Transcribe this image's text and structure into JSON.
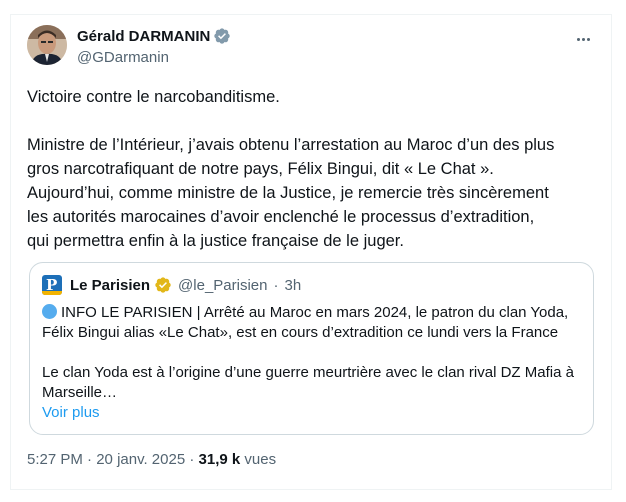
{
  "author": {
    "name": "Gérald DARMANIN",
    "handle": "@GDarmanin"
  },
  "tweet": {
    "line1": "Victoire contre le narcobanditisme.",
    "para2": [
      "Ministre de l’Intérieur, j’avais obtenu l’arrestation au Maroc d’un des plus",
      "gros narcotrafiquant de notre pays, Félix Bingui, dit « Le Chat ».",
      "Aujourd’hui, comme ministre de la Justice, je remercie très sincèrement",
      "les autorités marocaines d’avoir enclenché le processus d’extradition,",
      "qui permettra enfin à la justice française de le juger."
    ]
  },
  "quote": {
    "name": "Le Parisien",
    "handle": "@le_Parisien",
    "sep": "·",
    "time": "3h",
    "line1": "INFO LE PARISIEN | Arrêté au Maroc en mars 2024, le patron du clan Yoda,",
    "line2": "Félix Bingui alias «Le Chat», est en cours d’extradition ce lundi vers la France",
    "line3": "Le clan Yoda est à l’origine d’une guerre meurtrière avec le clan rival DZ Mafia à",
    "line4": "Marseille…",
    "more": "Voir plus"
  },
  "footer": {
    "time": "5:27 PM",
    "sep": " · ",
    "date": "20 janv. 2025",
    "sep2": " · ",
    "views_count": "31,9 k",
    "views_label": " vues"
  },
  "colors": {
    "text": "#0f1419",
    "secondary": "#536471",
    "link": "#1d9bf0",
    "verified_blue": "#1d9bf0",
    "verified_gold": "#e2b719"
  }
}
